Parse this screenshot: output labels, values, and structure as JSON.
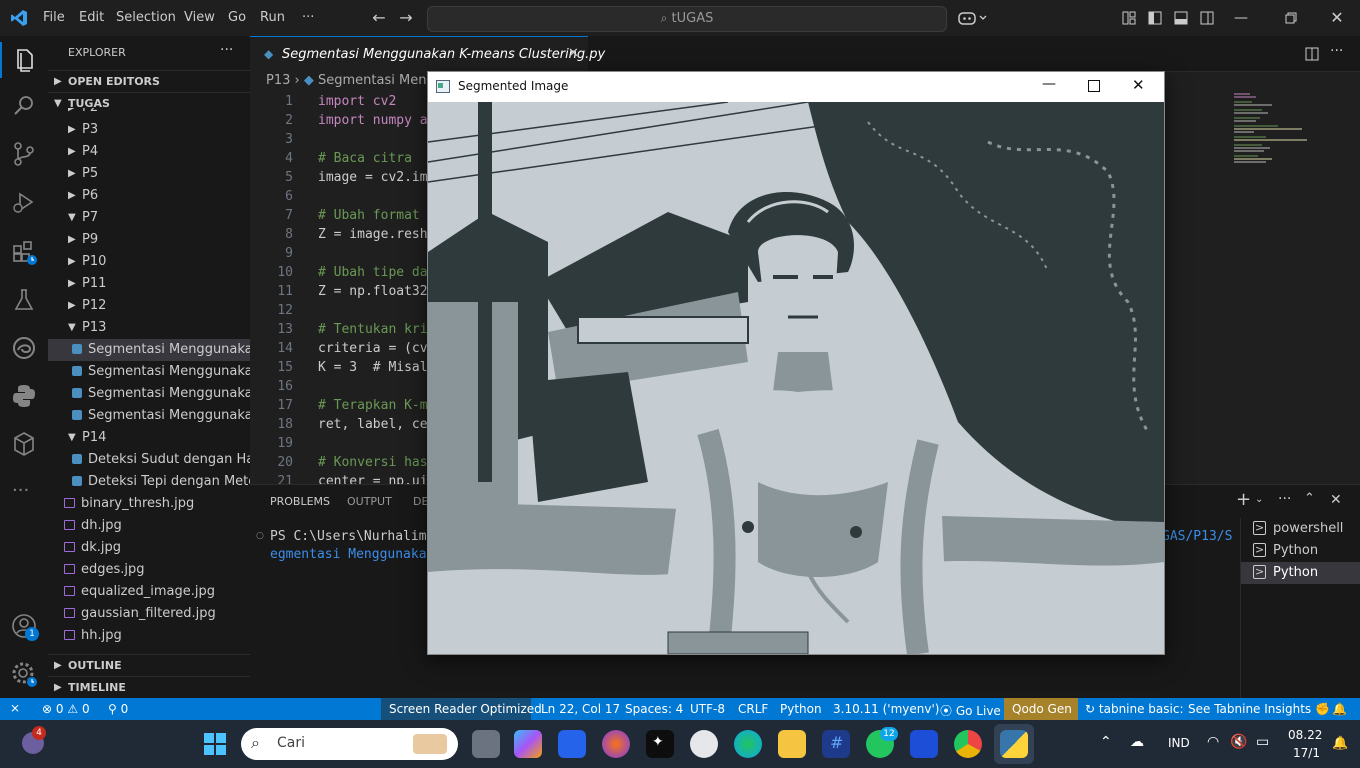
{
  "titlebar": {
    "menu": [
      "File",
      "Edit",
      "Selection",
      "View",
      "Go",
      "Run",
      "···"
    ],
    "search": "tUGAS"
  },
  "sidebar": {
    "title": "EXPLORER",
    "more": "···",
    "open_editors": "OPEN EDITORS",
    "workspace": "TUGAS",
    "items": [
      {
        "label": "P2",
        "type": "folder",
        "open": false
      },
      {
        "label": "P3",
        "type": "folder",
        "open": false
      },
      {
        "label": "P4",
        "type": "folder",
        "open": false
      },
      {
        "label": "P5",
        "type": "folder",
        "open": false
      },
      {
        "label": "P6",
        "type": "folder",
        "open": false
      },
      {
        "label": "P7",
        "type": "folder",
        "open": true
      },
      {
        "label": "P9",
        "type": "folder",
        "open": false
      },
      {
        "label": "P10",
        "type": "folder",
        "open": false
      },
      {
        "label": "P11",
        "type": "folder",
        "open": false
      },
      {
        "label": "P12",
        "type": "folder",
        "open": false
      },
      {
        "label": "P13",
        "type": "folder",
        "open": true
      },
      {
        "label": "Segmentasi Menggunaka...",
        "type": "py",
        "selected": true
      },
      {
        "label": "Segmentasi Menggunaka...",
        "type": "py"
      },
      {
        "label": "Segmentasi Menggunaka...",
        "type": "py"
      },
      {
        "label": "Segmentasi Menggunaka...",
        "type": "py"
      },
      {
        "label": "P14",
        "type": "folder",
        "open": true
      },
      {
        "label": "Deteksi Sudut dengan Har...",
        "type": "py"
      },
      {
        "label": "Deteksi Tepi dengan Meto...",
        "type": "py"
      },
      {
        "label": "binary_thresh.jpg",
        "type": "img"
      },
      {
        "label": "dh.jpg",
        "type": "img"
      },
      {
        "label": "dk.jpg",
        "type": "img"
      },
      {
        "label": "edges.jpg",
        "type": "img"
      },
      {
        "label": "equalized_image.jpg",
        "type": "img"
      },
      {
        "label": "gaussian_filtered.jpg",
        "type": "img"
      },
      {
        "label": "hh.jpg",
        "type": "img"
      }
    ],
    "outline": "OUTLINE",
    "timeline": "TIMELINE"
  },
  "editor": {
    "tab_label": "Segmentasi Menggunakan K-means Clustering.py",
    "breadcrumb_folder": "P13",
    "breadcrumb_file": "Segmentasi Mengg",
    "lines": [
      {
        "n": "1",
        "code": "import cv2"
      },
      {
        "n": "2",
        "code": "import numpy a"
      },
      {
        "n": "3",
        "code": ""
      },
      {
        "n": "4",
        "code": "# Baca citra"
      },
      {
        "n": "5",
        "code": "image = cv2.im"
      },
      {
        "n": "6",
        "code": ""
      },
      {
        "n": "7",
        "code": "# Ubah format"
      },
      {
        "n": "8",
        "code": "Z = image.resh"
      },
      {
        "n": "9",
        "code": ""
      },
      {
        "n": "10",
        "code": "# Ubah tipe da"
      },
      {
        "n": "11",
        "code": "Z = np.float32"
      },
      {
        "n": "12",
        "code": ""
      },
      {
        "n": "13",
        "code": "# Tentukan kri"
      },
      {
        "n": "14",
        "code": "criteria = (cv"
      },
      {
        "n": "15",
        "code": "K = 3  # Misal"
      },
      {
        "n": "16",
        "code": ""
      },
      {
        "n": "17",
        "code": "# Terapkan K-m"
      },
      {
        "n": "18",
        "code": "ret, label, ce"
      },
      {
        "n": "19",
        "code": ""
      },
      {
        "n": "20",
        "code": "# Konversi has"
      },
      {
        "n": "21",
        "code": "center = np.ui"
      }
    ]
  },
  "panel": {
    "tabs": [
      "PROBLEMS",
      "OUTPUT",
      "DE"
    ],
    "terminal_line1": "PS C:\\Users\\Nurhalim\\O",
    "terminal_line1_end": "GAS/P13/S",
    "terminal_line2": "egmentasi Menggunakan K",
    "terminals": [
      "powershell",
      "Python",
      "Python"
    ]
  },
  "cv_window": {
    "title": "Segmented Image"
  },
  "statusbar": {
    "remote": "⨯",
    "errors": "0",
    "warnings": "0",
    "ports": "0",
    "screen_reader": "Screen Reader Optimized",
    "position": "Ln 22, Col 17",
    "spaces": "Spaces: 4",
    "encoding": "UTF-8",
    "eol": "CRLF",
    "language": "Python",
    "interpreter": "3.10.11 ('myenv')",
    "golive": "Go Live",
    "qodo": "Qodo Gen",
    "tabnine": "tabnine basic:",
    "tabnine_insights": "See Tabnine Insights"
  },
  "taskbar": {
    "search_placeholder": "Cari",
    "badge_left": "4",
    "badge_whatsapp": "12",
    "lang": "IND",
    "time": "08.22",
    "date": "17/1"
  },
  "accounts_badge": "1",
  "colors": {
    "accent": "#0078d4",
    "qodo": "#a6832a",
    "keyword": "#c586c0",
    "comment": "#6a9955",
    "function": "#dcdcaa",
    "number": "#b5cea8"
  }
}
